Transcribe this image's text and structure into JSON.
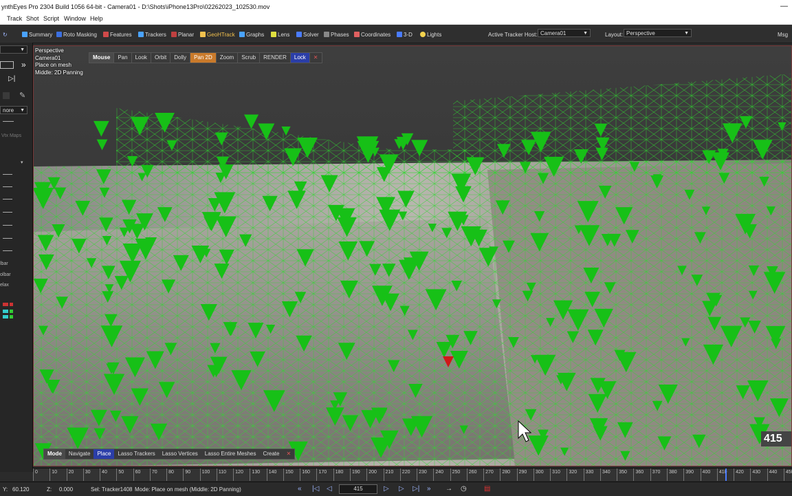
{
  "window": {
    "title": "ynthEyes Pro 2304 Build 1056 64-bit - Camera01 - D:\\Shots\\iPhone13Pro\\02262023_102530.mov",
    "minimize": "—"
  },
  "menu": [
    "Track",
    "Shot",
    "Script",
    "Window",
    "Help"
  ],
  "toolbar": {
    "items": [
      {
        "label": "Summary",
        "color": "#4aa3ff"
      },
      {
        "label": "Roto Masking",
        "color": "#3b6fe0"
      },
      {
        "label": "Features",
        "color": "#d04a4a"
      },
      {
        "label": "Trackers",
        "color": "#4aa3ff"
      },
      {
        "label": "Planar",
        "color": "#c04040"
      },
      {
        "label": "GeoHTrack",
        "color": "#f2c14e",
        "active": true
      },
      {
        "label": "Graphs",
        "color": "#4aa3ff"
      },
      {
        "label": "Lens",
        "color": "#e0e040"
      },
      {
        "label": "Solver",
        "color": "#4a7cff"
      },
      {
        "label": "Phases",
        "color": "#888888"
      },
      {
        "label": "Coordinates",
        "color": "#e06060"
      },
      {
        "label": "3-D",
        "color": "#4a7cff"
      },
      {
        "label": "Lights",
        "color": "#f2d24e"
      }
    ],
    "active_tracker_host_label": "Active Tracker Host:",
    "active_tracker_host_value": "Camera01",
    "layout_label": "Layout:",
    "layout_value": "Perspective",
    "msg_label": "Msg"
  },
  "sidebar": {
    "dropdown1": "",
    "dropdown2": "nore",
    "vtx_maps": "Vtx Maps",
    "labels": [
      "lbar",
      "olbar",
      "elax"
    ]
  },
  "viewport": {
    "overlay_lines": [
      "Perspective",
      "Camera01",
      "Place on mesh",
      "Middle: 2D Panning"
    ],
    "mouse_bar": [
      "Mouse",
      "Pan",
      "Look",
      "Orbit",
      "Dolly",
      "Pan 2D",
      "Zoom",
      "Scrub",
      "RENDER",
      "Lock",
      "✕"
    ],
    "mode_bar": [
      "Mode",
      "Navigate",
      "Place",
      "Lasso Trackers",
      "Lasso Vertices",
      "Lasso Entire Meshes",
      "Create",
      "✕"
    ],
    "frame_badge": "415",
    "colors": {
      "tracker": "#17c017",
      "selected": "#d01818",
      "mesh": "#2ed62e"
    }
  },
  "timeline": {
    "ticks": [
      0,
      10,
      20,
      30,
      40,
      50,
      60,
      70,
      80,
      90,
      100,
      110,
      120,
      130,
      140,
      150,
      160,
      170,
      180,
      190,
      200,
      210,
      220,
      230,
      240,
      250,
      260,
      270,
      280,
      290,
      300,
      310,
      320,
      330,
      340,
      350,
      360,
      370,
      380,
      390,
      400,
      410,
      420,
      430,
      440,
      450
    ],
    "current_frame": 415
  },
  "status": {
    "y_label": "Y:",
    "y_value": "60.120",
    "z_label": "Z:",
    "z_value": "0.000",
    "selection": "Sel: Tracker1408",
    "mode": "Mode: Place on mesh (Middle: 2D Panning)",
    "frame_field": "415"
  }
}
